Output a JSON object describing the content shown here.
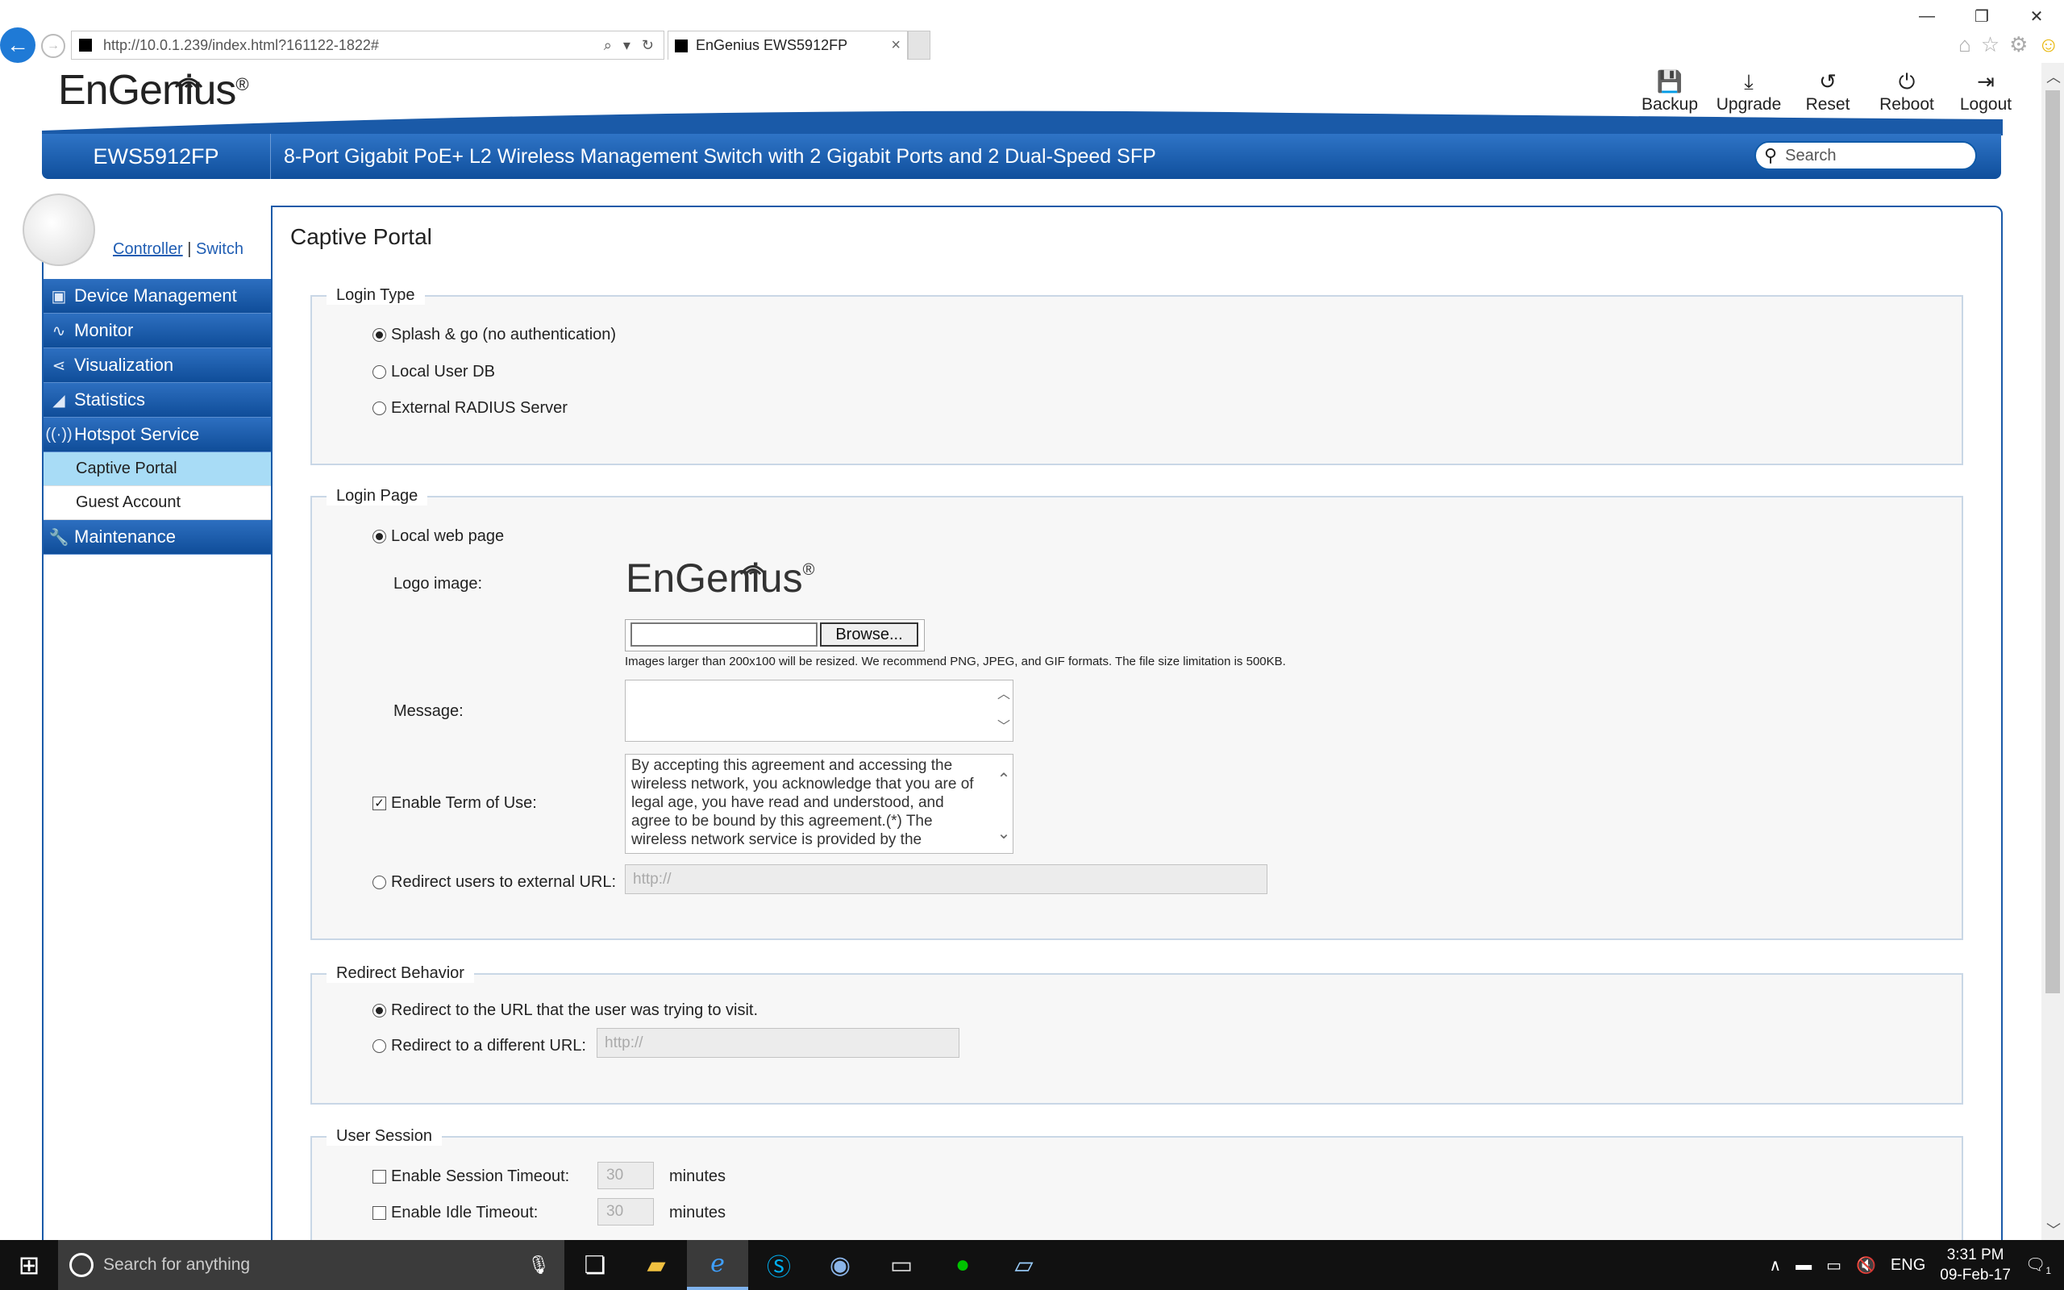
{
  "browser": {
    "url": "http://10.0.1.239/index.html?161122-1822#",
    "tab_title": "EnGenius EWS5912FP",
    "tab_close": "×",
    "win_minimize": "—",
    "win_restore": "❐",
    "win_close": "✕"
  },
  "header": {
    "logo_text": "EnGenius",
    "logo_reg": "®",
    "model": "EWS5912FP",
    "description": "8-Port Gigabit PoE+ L2 Wireless Management Switch with 2 Gigabit Ports and 2 Dual-Speed SFP",
    "search_placeholder": "Search",
    "toolbar": [
      {
        "label": "Backup",
        "icon": "save-icon"
      },
      {
        "label": "Upgrade",
        "icon": "download-icon"
      },
      {
        "label": "Reset",
        "icon": "reset-icon"
      },
      {
        "label": "Reboot",
        "icon": "power-icon"
      },
      {
        "label": "Logout",
        "icon": "logout-icon"
      }
    ]
  },
  "sidebar": {
    "view_controller": "Controller",
    "view_separator": "|",
    "view_switch": "Switch",
    "menu": [
      {
        "label": "Device Management",
        "icon": "device-icon"
      },
      {
        "label": "Monitor",
        "icon": "pulse-icon"
      },
      {
        "label": "Visualization",
        "icon": "share-icon"
      },
      {
        "label": "Statistics",
        "icon": "chart-icon"
      },
      {
        "label": "Hotspot Service",
        "icon": "wireless-icon"
      },
      {
        "label": "Maintenance",
        "icon": "wrench-icon"
      }
    ],
    "submenu": [
      {
        "label": "Captive Portal",
        "active": true
      },
      {
        "label": "Guest Account",
        "active": false
      }
    ]
  },
  "main": {
    "title": "Captive Portal",
    "login_type": {
      "legend": "Login Type",
      "options": [
        {
          "label": "Splash & go (no authentication)",
          "checked": true
        },
        {
          "label": "Local User DB",
          "checked": false
        },
        {
          "label": "External RADIUS Server",
          "checked": false
        }
      ]
    },
    "login_page": {
      "legend": "Login Page",
      "local_web_page": "Local web page",
      "logo_label": "Logo image:",
      "browse_label": "Browse...",
      "image_hint": "Images larger than 200x100 will be resized. We recommend PNG, JPEG, and GIF formats. The file size limitation is 500KB.",
      "message_label": "Message:",
      "message_value": "",
      "terms_label": "Enable Term of Use:",
      "terms_checked": true,
      "terms_text": "By accepting this agreement and accessing the wireless network, you acknowledge that you are of legal age, you have read and understood, and agree to be bound by this agreement.(*) The wireless network service is provided by the",
      "redirect_external_label": "Redirect users to external URL:",
      "redirect_external_placeholder": "http://"
    },
    "redirect_behavior": {
      "legend": "Redirect Behavior",
      "option_original": "Redirect to the URL that the user was trying to visit.",
      "option_different": "Redirect to a different URL:",
      "different_placeholder": "http://"
    },
    "user_session": {
      "legend": "User Session",
      "session_timeout_label": "Enable Session Timeout:",
      "session_timeout_value": "30",
      "idle_timeout_label": "Enable Idle Timeout:",
      "idle_timeout_value": "30",
      "unit": "minutes"
    }
  },
  "taskbar": {
    "search_placeholder": "Search for anything",
    "language": "ENG",
    "time": "3:31 PM",
    "date": "09-Feb-17",
    "notification_count": "1"
  },
  "colors": {
    "brand_blue": "#1a5aa8",
    "active_submenu": "#a8dcf6"
  }
}
